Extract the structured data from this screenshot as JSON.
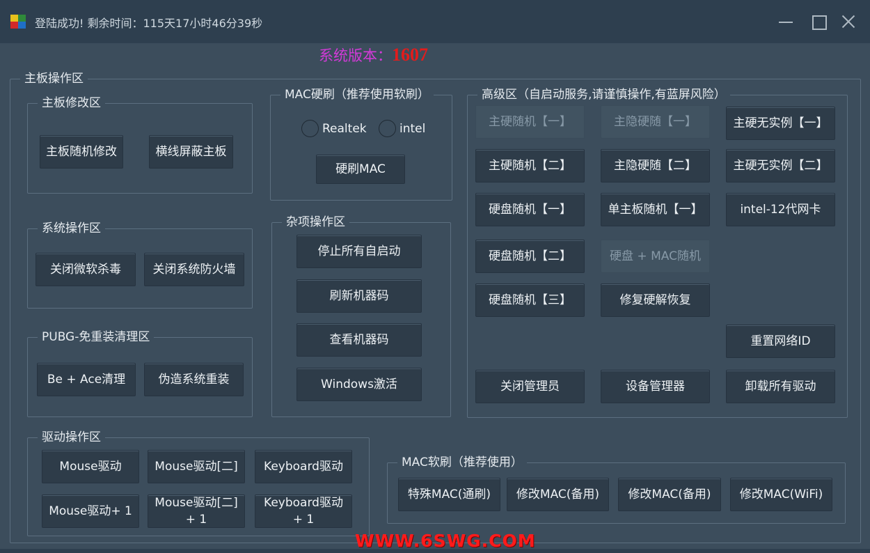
{
  "window": {
    "title": "登陆成功! 剩余时间：115天17小时46分39秒"
  },
  "version": {
    "label": "系统版本：",
    "number": "1607"
  },
  "mainboard_area": {
    "title": "主板操作区",
    "modify": {
      "title": "主板修改区",
      "buttons": [
        "主板随机修改",
        "横线屏蔽主板"
      ]
    },
    "system": {
      "title": "系统操作区",
      "buttons": [
        "关闭微软杀毒",
        "关闭系统防火墙"
      ]
    },
    "pubg": {
      "title": "PUBG-免重装清理区",
      "buttons": [
        "Be + Ace清理",
        "伪造系统重装"
      ]
    },
    "driver": {
      "title": "驱动操作区",
      "buttons": [
        "Mouse驱动",
        "Mouse驱动[二]",
        "Keyboard驱动",
        "Mouse驱动+ 1"
      ],
      "two_line_buttons": [
        {
          "line1": "Mouse驱动[二]",
          "line2": "+ 1"
        },
        {
          "line1": "Keyboard驱动",
          "line2": "+ 1"
        }
      ]
    }
  },
  "mac_hard": {
    "title": "MAC硬刷（推荐使用软刷）",
    "radios": [
      "Realtek",
      "intel"
    ],
    "button": "硬刷MAC"
  },
  "misc": {
    "title": "杂项操作区",
    "buttons": [
      "停止所有自启动",
      "刷新机器码",
      "查看机器码",
      "Windows激活"
    ]
  },
  "advanced": {
    "title": "高级区（自启动服务,请谨慎操作,有蓝屏风险）",
    "buttons": {
      "r1c1": "主硬随机【一】",
      "r1c2": "主隐硬随【一】",
      "r1c3": "主硬无实例【一】",
      "r2c1": "主硬随机【二】",
      "r2c2": "主隐硬随【二】",
      "r2c3": "主硬无实例【二】",
      "r3c1": "硬盘随机【一】",
      "r3c2": "单主板随机【一】",
      "r3c3": "intel-12代网卡",
      "r4c1": "硬盘随机【二】",
      "r4c2": "硬盘 + MAC随机",
      "r5c1": "硬盘随机【三】",
      "r5c2": "修复硬解恢复",
      "reset_net": "重置网络ID",
      "close_admin": "关闭管理员",
      "device_mgr": "设备管理器",
      "uninstall_drivers": "卸载所有驱动"
    }
  },
  "mac_soft": {
    "title": "MAC软刷（推荐使用）",
    "buttons": [
      "特殊MAC(通刷)",
      "修改MAC(备用)",
      "修改MAC(备用)",
      "修改MAC(WiFi)"
    ]
  },
  "watermark": "WWW.6SWG.COM",
  "colors": {
    "background": "#3c4d5c",
    "titlebar": "#2e3f4f",
    "button": "#2e3c49",
    "version_label": "#d33ad8",
    "version_number": "#e31c1c",
    "watermark": "#ff1b1b"
  }
}
